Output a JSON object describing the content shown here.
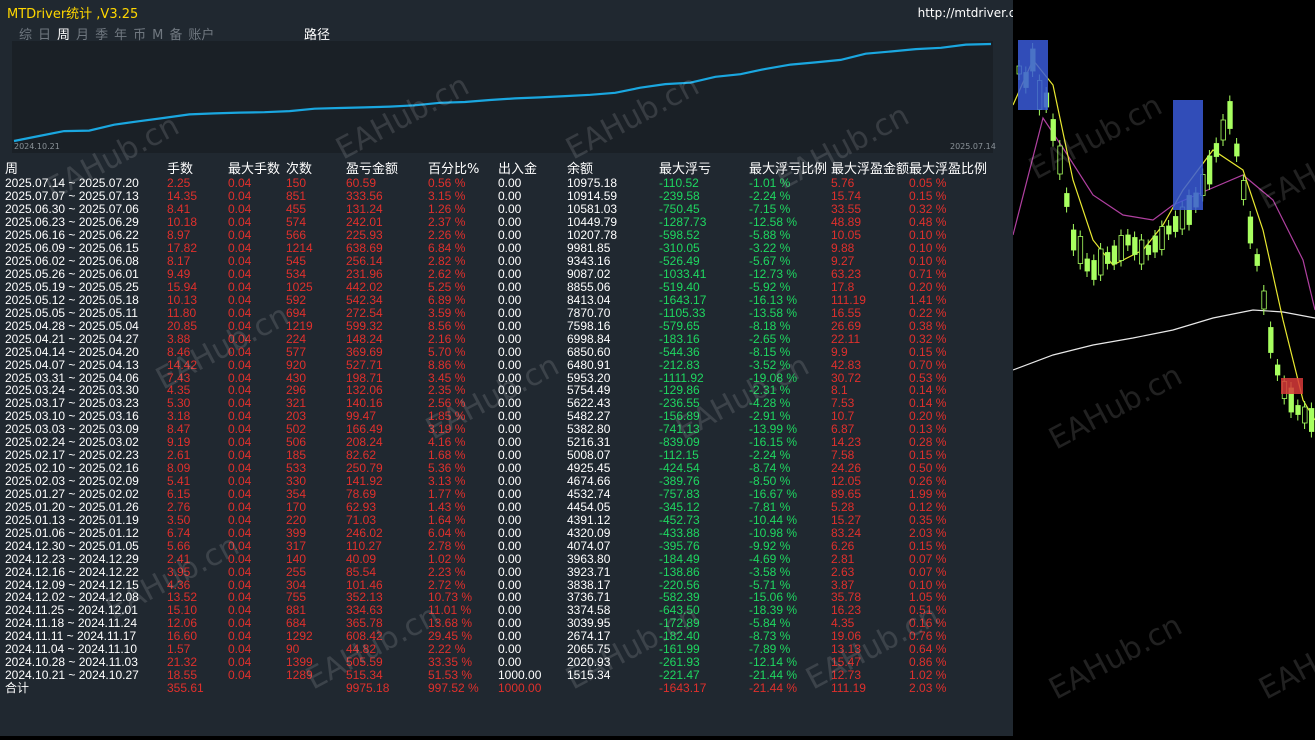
{
  "window": {
    "title": "MTDriver统计 ,V3.25",
    "url": "http://mtdriver.cn"
  },
  "tabs": [
    {
      "label": "综",
      "active": false
    },
    {
      "label": "日",
      "active": false
    },
    {
      "label": "周",
      "active": true
    },
    {
      "label": "月",
      "active": false
    },
    {
      "label": "季",
      "active": false
    },
    {
      "label": "年",
      "active": false
    },
    {
      "label": "币",
      "active": false
    },
    {
      "label": "M",
      "active": false
    },
    {
      "label": "备",
      "active": false
    },
    {
      "label": "账户",
      "active": false
    }
  ],
  "path_tab": "路径",
  "equity_chart": {
    "start_label": "2024.10.21",
    "end_label": "2025.07.14",
    "line_color": "#1aa7e0"
  },
  "watermark": "EAHub.cn",
  "columns": [
    "周",
    "手数",
    "最大手数",
    "次数",
    "盈亏金额",
    "百分比%",
    "出入金",
    "余额",
    "最大浮亏",
    "最大浮亏比例",
    "最大浮盈金额",
    "最大浮盈比例"
  ],
  "rows": [
    [
      "2025.07.14 ~ 2025.07.20",
      "2.25",
      "0.04",
      "150",
      "60.59",
      "0.56 %",
      "0.00",
      "10975.18",
      "-110.52",
      "-1.01 %",
      "5.76",
      "0.05 %"
    ],
    [
      "2025.07.07 ~ 2025.07.13",
      "14.35",
      "0.04",
      "851",
      "333.56",
      "3.15 %",
      "0.00",
      "10914.59",
      "-239.58",
      "-2.24 %",
      "15.74",
      "0.15 %"
    ],
    [
      "2025.06.30 ~ 2025.07.06",
      "8.41",
      "0.04",
      "455",
      "131.24",
      "1.26 %",
      "0.00",
      "10581.03",
      "-750.45",
      "-7.15 %",
      "33.55",
      "0.32 %"
    ],
    [
      "2025.06.23 ~ 2025.06.29",
      "10.18",
      "0.04",
      "574",
      "242.01",
      "2.37 %",
      "0.00",
      "10449.79",
      "-1287.73",
      "-12.58 %",
      "48.89",
      "0.48 %"
    ],
    [
      "2025.06.16 ~ 2025.06.22",
      "8.97",
      "0.04",
      "566",
      "225.93",
      "2.26 %",
      "0.00",
      "10207.78",
      "-598.52",
      "-5.88 %",
      "10.05",
      "0.10 %"
    ],
    [
      "2025.06.09 ~ 2025.06.15",
      "17.82",
      "0.04",
      "1214",
      "638.69",
      "6.84 %",
      "0.00",
      "9981.85",
      "-310.05",
      "-3.22 %",
      "9.88",
      "0.10 %"
    ],
    [
      "2025.06.02 ~ 2025.06.08",
      "8.17",
      "0.04",
      "545",
      "256.14",
      "2.82 %",
      "0.00",
      "9343.16",
      "-526.49",
      "-5.67 %",
      "9.27",
      "0.10 %"
    ],
    [
      "2025.05.26 ~ 2025.06.01",
      "9.49",
      "0.04",
      "534",
      "231.96",
      "2.62 %",
      "0.00",
      "9087.02",
      "-1033.41",
      "-12.73 %",
      "63.23",
      "0.71 %"
    ],
    [
      "2025.05.19 ~ 2025.05.25",
      "15.94",
      "0.04",
      "1025",
      "442.02",
      "5.25 %",
      "0.00",
      "8855.06",
      "-519.40",
      "-5.92 %",
      "17.8",
      "0.20 %"
    ],
    [
      "2025.05.12 ~ 2025.05.18",
      "10.13",
      "0.04",
      "592",
      "542.34",
      "6.89 %",
      "0.00",
      "8413.04",
      "-1643.17",
      "-16.13 %",
      "111.19",
      "1.41 %"
    ],
    [
      "2025.05.05 ~ 2025.05.11",
      "11.80",
      "0.04",
      "694",
      "272.54",
      "3.59 %",
      "0.00",
      "7870.70",
      "-1105.33",
      "-13.58 %",
      "16.55",
      "0.22 %"
    ],
    [
      "2025.04.28 ~ 2025.05.04",
      "20.85",
      "0.04",
      "1219",
      "599.32",
      "8.56 %",
      "0.00",
      "7598.16",
      "-579.65",
      "-8.18 %",
      "26.69",
      "0.38 %"
    ],
    [
      "2025.04.21 ~ 2025.04.27",
      "3.88",
      "0.04",
      "224",
      "148.24",
      "2.16 %",
      "0.00",
      "6998.84",
      "-183.16",
      "-2.65 %",
      "22.11",
      "0.32 %"
    ],
    [
      "2025.04.14 ~ 2025.04.20",
      "8.46",
      "0.04",
      "577",
      "369.69",
      "5.70 %",
      "0.00",
      "6850.60",
      "-544.36",
      "-8.15 %",
      "9.9",
      "0.15 %"
    ],
    [
      "2025.04.07 ~ 2025.04.13",
      "14.42",
      "0.04",
      "920",
      "527.71",
      "8.86 %",
      "0.00",
      "6480.91",
      "-212.83",
      "-3.52 %",
      "42.83",
      "0.70 %"
    ],
    [
      "2025.03.31 ~ 2025.04.06",
      "7.43",
      "0.04",
      "430",
      "198.71",
      "3.45 %",
      "0.00",
      "5953.20",
      "-1111.92",
      "-19.08 %",
      "30.72",
      "0.53 %"
    ],
    [
      "2025.03.24 ~ 2025.03.30",
      "4.35",
      "0.04",
      "296",
      "132.06",
      "2.35 %",
      "0.00",
      "5754.49",
      "-129.86",
      "-2.31 %",
      "8.1",
      "0.14 %"
    ],
    [
      "2025.03.17 ~ 2025.03.23",
      "5.30",
      "0.04",
      "321",
      "140.16",
      "2.56 %",
      "0.00",
      "5622.43",
      "-236.55",
      "-4.28 %",
      "7.53",
      "0.14 %"
    ],
    [
      "2025.03.10 ~ 2025.03.16",
      "3.18",
      "0.04",
      "203",
      "99.47",
      "1.85 %",
      "0.00",
      "5482.27",
      "-156.89",
      "-2.91 %",
      "10.7",
      "0.20 %"
    ],
    [
      "2025.03.03 ~ 2025.03.09",
      "8.47",
      "0.04",
      "502",
      "166.49",
      "3.19 %",
      "0.00",
      "5382.80",
      "-741.13",
      "-13.99 %",
      "6.87",
      "0.13 %"
    ],
    [
      "2025.02.24 ~ 2025.03.02",
      "9.19",
      "0.04",
      "506",
      "208.24",
      "4.16 %",
      "0.00",
      "5216.31",
      "-839.09",
      "-16.15 %",
      "14.23",
      "0.28 %"
    ],
    [
      "2025.02.17 ~ 2025.02.23",
      "2.61",
      "0.04",
      "185",
      "82.62",
      "1.68 %",
      "0.00",
      "5008.07",
      "-112.15",
      "-2.24 %",
      "7.58",
      "0.15 %"
    ],
    [
      "2025.02.10 ~ 2025.02.16",
      "8.09",
      "0.04",
      "533",
      "250.79",
      "5.36 %",
      "0.00",
      "4925.45",
      "-424.54",
      "-8.74 %",
      "24.26",
      "0.50 %"
    ],
    [
      "2025.02.03 ~ 2025.02.09",
      "5.41",
      "0.04",
      "330",
      "141.92",
      "3.13 %",
      "0.00",
      "4674.66",
      "-389.76",
      "-8.50 %",
      "12.05",
      "0.26 %"
    ],
    [
      "2025.01.27 ~ 2025.02.02",
      "6.15",
      "0.04",
      "354",
      "78.69",
      "1.77 %",
      "0.00",
      "4532.74",
      "-757.83",
      "-16.67 %",
      "89.65",
      "1.99 %"
    ],
    [
      "2025.01.20 ~ 2025.01.26",
      "2.76",
      "0.04",
      "170",
      "62.93",
      "1.43 %",
      "0.00",
      "4454.05",
      "-345.12",
      "-7.81 %",
      "5.28",
      "0.12 %"
    ],
    [
      "2025.01.13 ~ 2025.01.19",
      "3.50",
      "0.04",
      "220",
      "71.03",
      "1.64 %",
      "0.00",
      "4391.12",
      "-452.73",
      "-10.44 %",
      "15.27",
      "0.35 %"
    ],
    [
      "2025.01.06 ~ 2025.01.12",
      "6.74",
      "0.04",
      "399",
      "246.02",
      "6.04 %",
      "0.00",
      "4320.09",
      "-433.88",
      "-10.98 %",
      "83.24",
      "2.03 %"
    ],
    [
      "2024.12.30 ~ 2025.01.05",
      "5.66",
      "0.04",
      "317",
      "110.27",
      "2.78 %",
      "0.00",
      "4074.07",
      "-395.76",
      "-9.92 %",
      "6.26",
      "0.15 %"
    ],
    [
      "2024.12.23 ~ 2024.12.29",
      "2.41",
      "0.04",
      "140",
      "40.09",
      "1.02 %",
      "0.00",
      "3963.80",
      "-184.49",
      "-4.69 %",
      "2.81",
      "0.07 %"
    ],
    [
      "2024.12.16 ~ 2024.12.22",
      "3.95",
      "0.04",
      "255",
      "85.54",
      "2.23 %",
      "0.00",
      "3923.71",
      "-138.86",
      "-3.58 %",
      "2.63",
      "0.07 %"
    ],
    [
      "2024.12.09 ~ 2024.12.15",
      "4.36",
      "0.04",
      "304",
      "101.46",
      "2.72 %",
      "0.00",
      "3838.17",
      "-220.56",
      "-5.71 %",
      "3.87",
      "0.10 %"
    ],
    [
      "2024.12.02 ~ 2024.12.08",
      "13.52",
      "0.04",
      "755",
      "352.13",
      "10.73 %",
      "0.00",
      "3736.71",
      "-582.39",
      "-15.06 %",
      "35.78",
      "1.05 %"
    ],
    [
      "2024.11.25 ~ 2024.12.01",
      "15.10",
      "0.04",
      "881",
      "334.63",
      "11.01 %",
      "0.00",
      "3374.58",
      "-643.50",
      "-18.39 %",
      "16.23",
      "0.51 %"
    ],
    [
      "2024.11.18 ~ 2024.11.24",
      "12.06",
      "0.04",
      "684",
      "365.78",
      "13.68 %",
      "0.00",
      "3039.95",
      "-172.89",
      "-5.84 %",
      "4.35",
      "0.16 %"
    ],
    [
      "2024.11.11 ~ 2024.11.17",
      "16.60",
      "0.04",
      "1292",
      "608.42",
      "29.45 %",
      "0.00",
      "2674.17",
      "-182.40",
      "-8.73 %",
      "19.06",
      "0.76 %"
    ],
    [
      "2024.11.04 ~ 2024.11.10",
      "1.57",
      "0.04",
      "90",
      "44.82",
      "2.22 %",
      "0.00",
      "2065.75",
      "-161.99",
      "-7.89 %",
      "13.13",
      "0.64 %"
    ],
    [
      "2024.10.28 ~ 2024.11.03",
      "21.32",
      "0.04",
      "1399",
      "505.59",
      "33.35 %",
      "0.00",
      "2020.93",
      "-261.93",
      "-12.14 %",
      "15.47",
      "0.86 %"
    ],
    [
      "2024.10.21 ~ 2024.10.27",
      "18.55",
      "0.04",
      "1289",
      "515.34",
      "51.53 %",
      "1000.00",
      "1515.34",
      "-221.47",
      "-21.44 %",
      "12.73",
      "1.02 %"
    ]
  ],
  "total": [
    "合计",
    "355.61",
    "",
    "",
    "9975.18",
    "997.52 %",
    "1000.00",
    "",
    "-1643.17",
    "-21.44 %",
    "111.19",
    "2.03 %"
  ],
  "colors": {
    "panel_bg": "#202830",
    "profit": "#e0302c",
    "loss": "#1ed760",
    "accent": "#ffd700"
  }
}
